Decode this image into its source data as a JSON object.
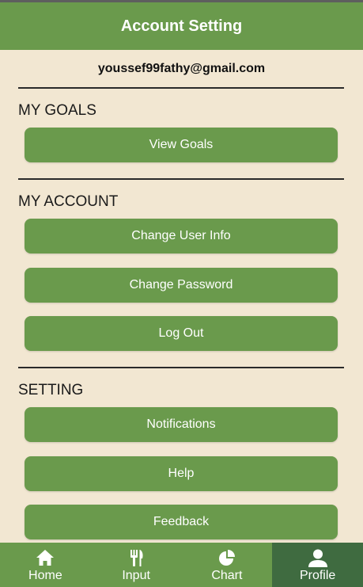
{
  "header": {
    "title": "Account Setting"
  },
  "account": {
    "email": "youssef99fathy@gmail.com"
  },
  "sections": {
    "goals": {
      "title": "MY GOALS",
      "view_goals": "View Goals"
    },
    "account": {
      "title": "MY ACCOUNT",
      "change_user_info": "Change User Info",
      "change_password": "Change Password",
      "log_out": "Log Out"
    },
    "setting": {
      "title": "SETTING",
      "notifications": "Notifications",
      "help": "Help",
      "feedback": "Feedback"
    }
  },
  "bottom_nav": {
    "items": [
      {
        "label": "Home",
        "icon": "home-icon"
      },
      {
        "label": "Input",
        "icon": "fork-knife-icon"
      },
      {
        "label": "Chart",
        "icon": "pie-chart-icon"
      },
      {
        "label": "Profile",
        "icon": "person-icon"
      }
    ],
    "active": "Profile"
  },
  "colors": {
    "primary": "#6a9a4c",
    "active_tab": "#3f6b40",
    "background": "#f2e7d2",
    "text": "#111111"
  }
}
